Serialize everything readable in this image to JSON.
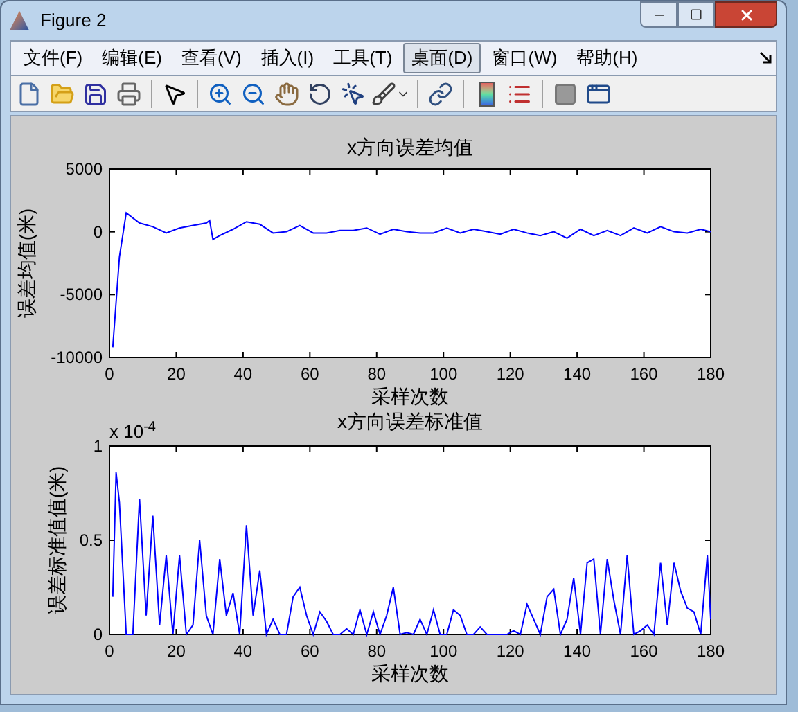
{
  "window": {
    "title": "Figure 2"
  },
  "menu": [
    {
      "label": "文件(F)",
      "selected": false
    },
    {
      "label": "编辑(E)",
      "selected": false
    },
    {
      "label": "查看(V)",
      "selected": false
    },
    {
      "label": "插入(I)",
      "selected": false
    },
    {
      "label": "工具(T)",
      "selected": false
    },
    {
      "label": "桌面(D)",
      "selected": true
    },
    {
      "label": "窗口(W)",
      "selected": false
    },
    {
      "label": "帮助(H)",
      "selected": false
    }
  ],
  "toolbar": [
    {
      "kind": "new"
    },
    {
      "kind": "open"
    },
    {
      "kind": "save"
    },
    {
      "kind": "print"
    },
    {
      "kind": "separator"
    },
    {
      "kind": "pointer"
    },
    {
      "kind": "separator"
    },
    {
      "kind": "zoom-in"
    },
    {
      "kind": "zoom-out"
    },
    {
      "kind": "pan"
    },
    {
      "kind": "rotate"
    },
    {
      "kind": "data-cursor"
    },
    {
      "kind": "brush"
    },
    {
      "kind": "separator"
    },
    {
      "kind": "link"
    },
    {
      "kind": "separator"
    },
    {
      "kind": "colorbar"
    },
    {
      "kind": "legend"
    },
    {
      "kind": "separator"
    },
    {
      "kind": "hide-tools"
    },
    {
      "kind": "show-tools"
    }
  ],
  "plots": [
    {
      "chart_data": {
        "type": "line",
        "title": "x方向误差均值",
        "xlabel": "采样次数",
        "ylabel": "误差均值(米)",
        "xlim": [
          0,
          180
        ],
        "ylim": [
          -10000,
          5000
        ],
        "xticks": [
          0,
          20,
          40,
          60,
          80,
          100,
          120,
          140,
          160,
          180
        ],
        "yticks": [
          -10000,
          -5000,
          0,
          5000
        ],
        "x": [
          1,
          3,
          5,
          9,
          13,
          17,
          21,
          25,
          29,
          30,
          31,
          33,
          37,
          41,
          45,
          49,
          53,
          57,
          61,
          65,
          69,
          73,
          77,
          81,
          85,
          89,
          93,
          97,
          101,
          105,
          109,
          113,
          117,
          121,
          125,
          129,
          133,
          137,
          141,
          145,
          149,
          153,
          157,
          161,
          165,
          169,
          173,
          177,
          180
        ],
        "series": [
          {
            "color": "#0000ff",
            "values": [
              -9200,
              -2000,
              1500,
              700,
              400,
              -100,
              300,
              500,
              700,
              900,
              -600,
              -300,
              200,
              800,
              600,
              -100,
              0,
              500,
              -100,
              -100,
              100,
              100,
              300,
              -200,
              200,
              0,
              -100,
              -100,
              300,
              -100,
              200,
              0,
              -200,
              200,
              -100,
              -300,
              0,
              -500,
              200,
              -300,
              100,
              -300,
              300,
              -100,
              400,
              0,
              -100,
              200,
              0
            ]
          }
        ]
      }
    },
    {
      "exponent_label": "x 10$^{-4}$",
      "chart_data": {
        "type": "line",
        "title": "x方向误差标准值",
        "xlabel": "采样次数",
        "ylabel": "误差标准值值(米)",
        "xlim": [
          0,
          180
        ],
        "ylim": [
          0,
          1
        ],
        "xticks": [
          0,
          20,
          40,
          60,
          80,
          100,
          120,
          140,
          160,
          180
        ],
        "yticks": [
          0,
          0.5,
          1
        ],
        "x": [
          1,
          2,
          3,
          5,
          7,
          9,
          11,
          13,
          15,
          17,
          19,
          21,
          23,
          25,
          27,
          29,
          31,
          33,
          35,
          37,
          39,
          41,
          43,
          45,
          47,
          49,
          51,
          53,
          55,
          57,
          59,
          61,
          63,
          65,
          67,
          69,
          71,
          73,
          75,
          77,
          79,
          81,
          83,
          85,
          87,
          89,
          91,
          93,
          95,
          97,
          99,
          101,
          103,
          105,
          107,
          109,
          111,
          113,
          115,
          117,
          119,
          121,
          123,
          125,
          127,
          129,
          131,
          133,
          135,
          137,
          139,
          141,
          143,
          145,
          147,
          149,
          151,
          153,
          155,
          157,
          159,
          161,
          163,
          165,
          167,
          169,
          171,
          173,
          175,
          177,
          179,
          180
        ],
        "series": [
          {
            "color": "#0000ff",
            "values": [
              0.2,
              0.86,
              0.7,
              0,
              0,
              0.72,
              0.1,
              0.63,
              0.05,
              0.42,
              0,
              0.42,
              0,
              0.05,
              0.5,
              0.1,
              0,
              0.4,
              0.1,
              0.22,
              0,
              0.58,
              0.1,
              0.34,
              0,
              0.08,
              0,
              0,
              0.2,
              0.25,
              0.1,
              0,
              0.12,
              0.07,
              0,
              0,
              0.03,
              0,
              0.13,
              0,
              0.12,
              0,
              0.1,
              0.25,
              0,
              0.01,
              0,
              0.08,
              0,
              0.13,
              0,
              0,
              0.13,
              0.1,
              0,
              0,
              0.04,
              0,
              0,
              0,
              0,
              0.02,
              0,
              0.16,
              0.08,
              0,
              0.2,
              0.24,
              0,
              0.08,
              0.3,
              0,
              0.38,
              0.4,
              0,
              0.4,
              0.18,
              0,
              0.42,
              0,
              0.02,
              0.05,
              0,
              0.38,
              0.05,
              0.38,
              0.23,
              0.14,
              0.12,
              0,
              0.42,
              0.08
            ]
          }
        ]
      }
    }
  ]
}
